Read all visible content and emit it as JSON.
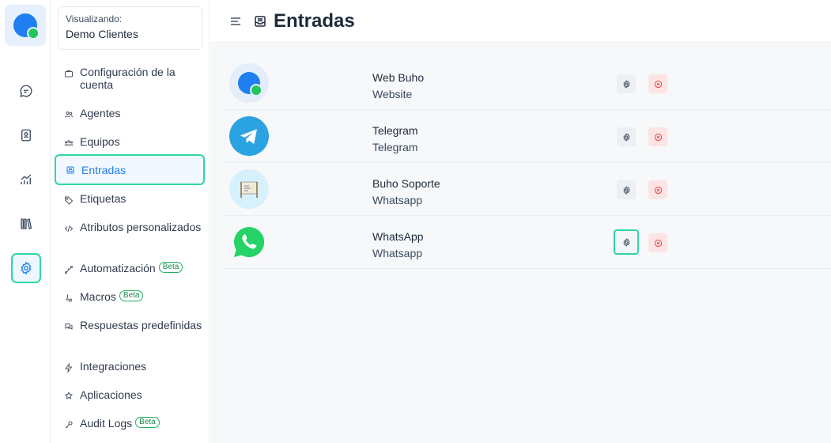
{
  "account": {
    "caption": "Visualizando:",
    "name": "Demo Clientes"
  },
  "rail": {
    "items": [
      {
        "icon": "chat-icon"
      },
      {
        "icon": "contacts-icon"
      },
      {
        "icon": "reports-icon"
      },
      {
        "icon": "library-icon"
      },
      {
        "icon": "settings-icon",
        "active": true
      }
    ]
  },
  "sidebar": {
    "items": [
      {
        "label": "Configuración de la cuenta",
        "icon": "briefcase-icon"
      },
      {
        "label": "Agentes",
        "icon": "people-icon"
      },
      {
        "label": "Equipos",
        "icon": "team-icon"
      },
      {
        "label": "Entradas",
        "icon": "inbox-icon",
        "active": true
      },
      {
        "label": "Etiquetas",
        "icon": "tag-icon"
      },
      {
        "label": "Atributos personalizados",
        "icon": "code-icon"
      },
      {
        "label": "Automatización",
        "icon": "automation-icon",
        "badge": "Beta"
      },
      {
        "label": "Macros",
        "icon": "macros-icon",
        "badge": "Beta"
      },
      {
        "label": "Respuestas predefinidas",
        "icon": "canned-responses-icon"
      },
      {
        "label": "Integraciones",
        "icon": "flash-icon"
      },
      {
        "label": "Aplicaciones",
        "icon": "apps-icon"
      },
      {
        "label": "Audit Logs",
        "icon": "key-icon",
        "badge": "Beta"
      }
    ]
  },
  "header": {
    "title": "Entradas"
  },
  "inboxes": [
    {
      "name": "Web Buho",
      "type": "Website",
      "avatar": "website-logo"
    },
    {
      "name": "Telegram",
      "type": "Telegram",
      "avatar": "telegram-logo"
    },
    {
      "name": "Buho Soporte",
      "type": "Whatsapp",
      "avatar": "support-sign-logo"
    },
    {
      "name": "WhatsApp",
      "type": "Whatsapp",
      "avatar": "whatsapp-logo"
    }
  ],
  "colors": {
    "accent": "#1f7ff0",
    "focus": "#2fd7a2",
    "danger": "#e5484d",
    "badge": "#22b05b"
  }
}
